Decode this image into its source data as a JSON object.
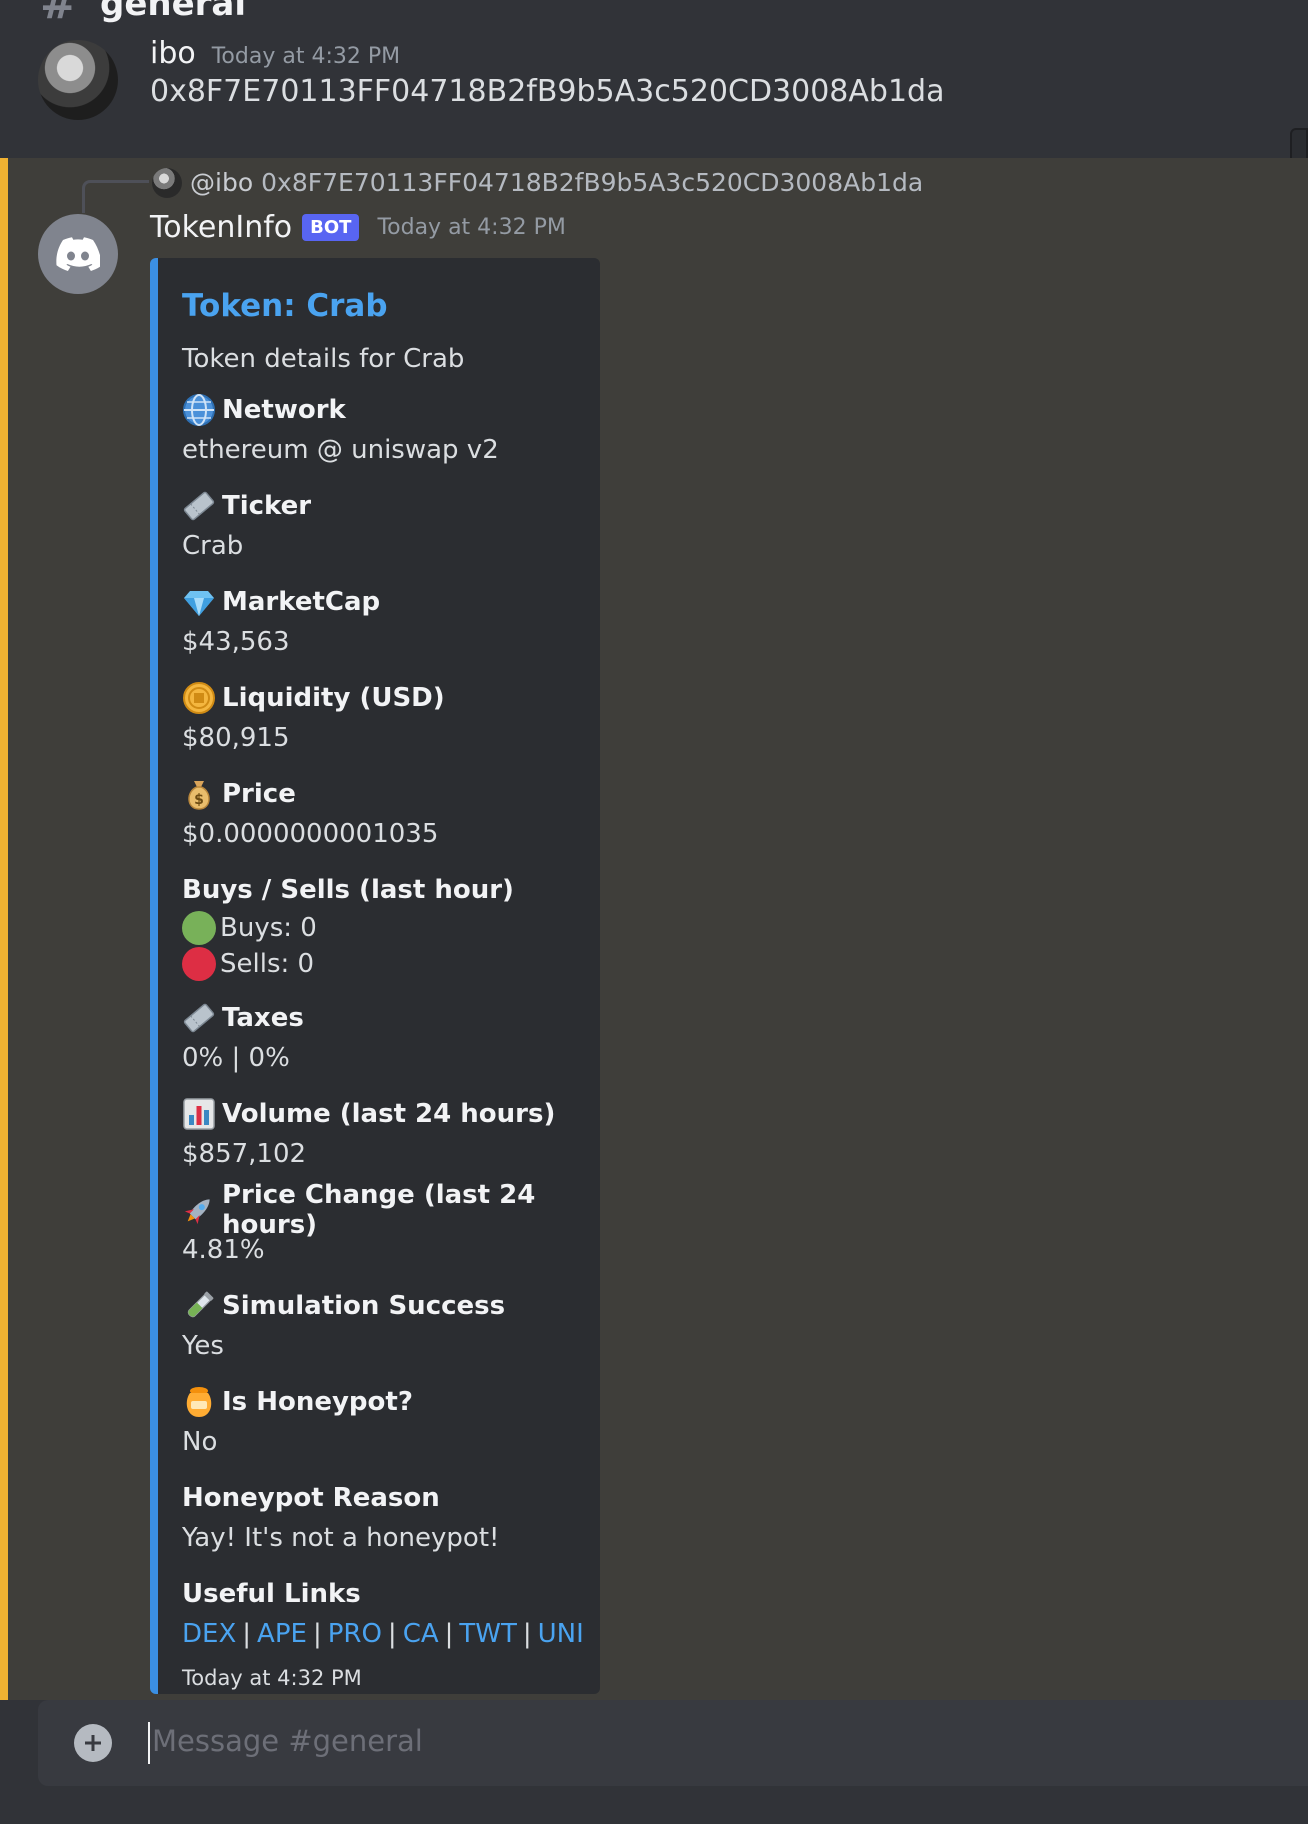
{
  "channel": {
    "hash": "#",
    "name": "general"
  },
  "message_user": {
    "username": "ibo",
    "timestamp": "Today at 4:32 PM",
    "content": "0x8F7E70113FF04718B2fB9b5A3c520CD3008Ab1da"
  },
  "message_bot": {
    "reply": {
      "mention": "@ibo",
      "text": "0x8F7E70113FF04718B2fB9b5A3c520CD3008Ab1da"
    },
    "username": "TokenInfo",
    "badge": "BOT",
    "timestamp": "Today at 4:32 PM",
    "embed": {
      "title": "Token: Crab",
      "description": "Token details for Crab",
      "fields": {
        "network": {
          "name": "Network",
          "value": "ethereum @ uniswap v2",
          "icon": "globe-icon"
        },
        "ticker": {
          "name": "Ticker",
          "value": "Crab",
          "icon": "ticket-icon"
        },
        "marketcap": {
          "name": "MarketCap",
          "value": "$43,563",
          "icon": "gem-icon"
        },
        "liquidity": {
          "name": "Liquidity (USD)",
          "value": "$80,915",
          "icon": "coin-icon"
        },
        "price": {
          "name": "Price",
          "value": "$0.0000000001035",
          "icon": "money-bag-icon"
        },
        "buys_sells": {
          "name": "Buys /  Sells (last hour)",
          "buys": "Buys: 0",
          "sells": "Sells: 0"
        },
        "taxes": {
          "name": "Taxes",
          "value": "0% | 0%",
          "icon": "ticket-icon"
        },
        "volume": {
          "name": "Volume (last 24 hours)",
          "value": "$857,102",
          "icon": "bar-chart-icon"
        },
        "price_change": {
          "name": "Price Change (last 24 hours)",
          "value": "4.81%",
          "icon": "rocket-icon"
        },
        "simulation": {
          "name": "Simulation Success",
          "value": "Yes",
          "icon": "test-tube-icon"
        },
        "honeypot": {
          "name": "Is Honeypot?",
          "value": "No",
          "icon": "honey-pot-icon"
        },
        "honeypot_reason": {
          "name": "Honeypot Reason",
          "value": "Yay! It's not a honeypot!"
        },
        "useful_links": {
          "name": "Useful Links",
          "links": [
            "DEX",
            "APE",
            "PRO",
            "CA",
            "TWT",
            "UNI"
          ],
          "separator": "|"
        }
      },
      "footer": "Today at 4:32 PM",
      "accent_color": "#3b8fe3"
    }
  },
  "input": {
    "placeholder": "Message #general"
  },
  "colors": {
    "mention_highlight": "#f0b232",
    "link": "#4aa3f0",
    "bot_badge": "#5865f2"
  }
}
